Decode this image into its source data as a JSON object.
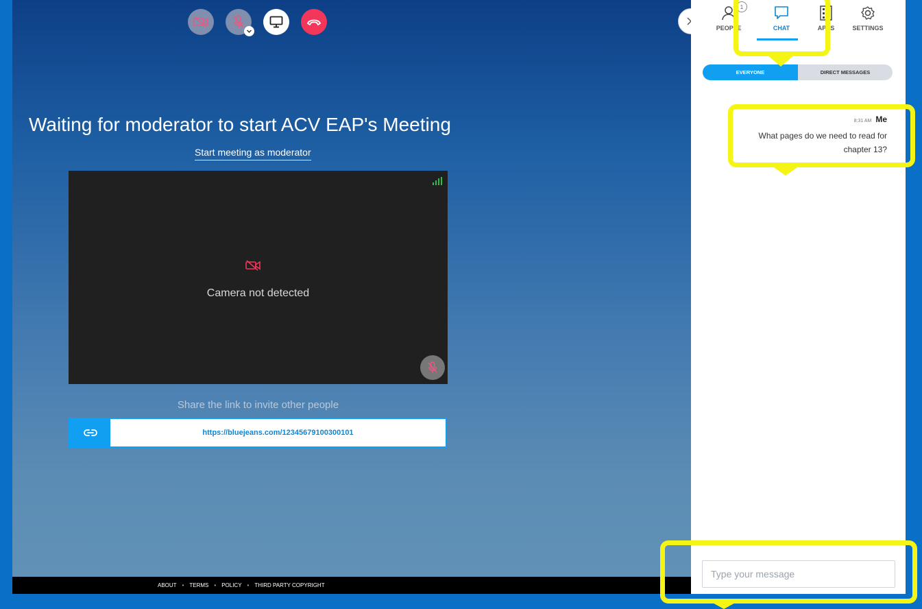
{
  "meeting": {
    "title": "Waiting for moderator to start ACV EAP's Meeting",
    "start_link": "Start meeting as moderator",
    "camera_status": "Camera not detected",
    "share_text": "Share the link to invite other people",
    "share_url": "https://bluejeans.com/12345679100300101"
  },
  "footer": {
    "links": [
      "ABOUT",
      "TERMS",
      "POLICY",
      "THIRD PARTY COPYRIGHT"
    ],
    "separator": "•"
  },
  "panel": {
    "tabs": [
      "PEOPLE",
      "CHAT",
      "APPS",
      "SETTINGS"
    ],
    "people_badge": "1",
    "segments": [
      "EVERYONE",
      "DIRECT MESSAGES"
    ],
    "messages": [
      {
        "time": "8:31 AM",
        "sender": "Me",
        "text": "What pages do we need to read for chapter 13?"
      }
    ],
    "input_placeholder": "Type your message"
  },
  "colors": {
    "accent": "#11a0f1",
    "hangup": "#f2375a",
    "highlight": "#f5f515",
    "border_blue": "#0a6fc7"
  },
  "icons": [
    "camera-off-icon",
    "mic-off-icon",
    "screen-share-icon",
    "hangup-icon",
    "close-icon",
    "people-icon",
    "chat-icon",
    "apps-icon",
    "settings-icon",
    "signal-icon",
    "link-icon"
  ]
}
